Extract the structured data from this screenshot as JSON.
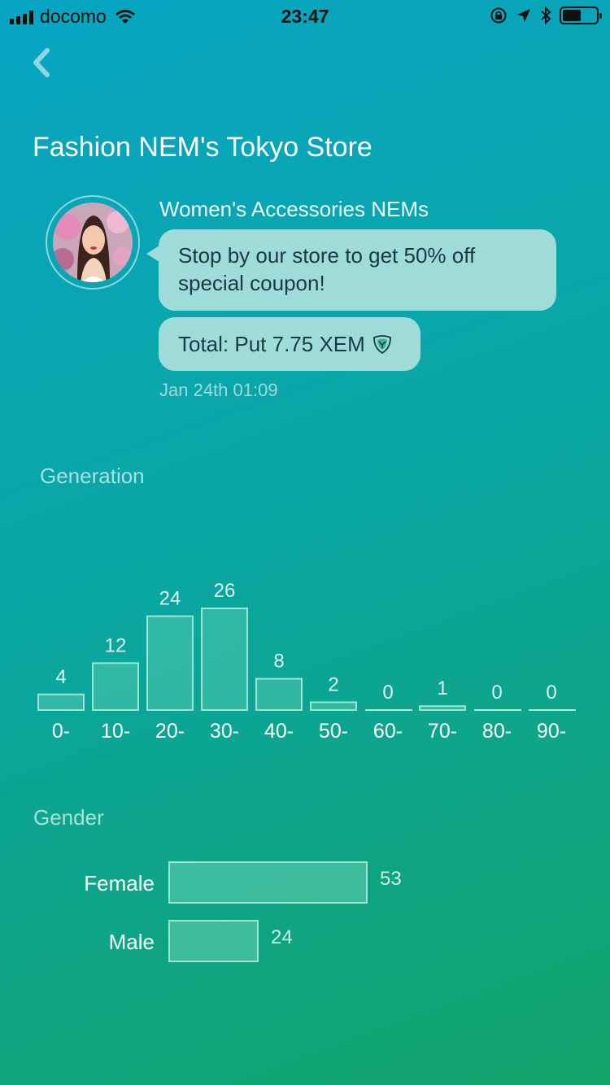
{
  "status_bar": {
    "carrier": "docomo",
    "time": "23:47",
    "battery_level": 0.55
  },
  "header": {
    "back_icon": "chevron-left-icon",
    "title": "Fashion NEM's Tokyo Store"
  },
  "message": {
    "sender": "Women's Accessories NEMs",
    "text": "Stop by our store to get 50% off special coupon!",
    "total": "Total: Put 7.75 XEM",
    "total_icon": "xem-coin-icon",
    "timestamp": "Jan 24th 01:09"
  },
  "generation": {
    "title": "Generation"
  },
  "gender": {
    "title": "Gender",
    "rows": [
      {
        "label": "Female",
        "value": 53,
        "display": "53"
      },
      {
        "label": "Male",
        "value": 24,
        "display": "24"
      }
    ]
  },
  "chart_data": {
    "type": "bar",
    "categories": [
      "0-",
      "10-",
      "20-",
      "30-",
      "40-",
      "50-",
      "60-",
      "70-",
      "80-",
      "90-"
    ],
    "values": [
      4,
      12,
      24,
      26,
      8,
      2,
      0,
      1,
      0,
      0
    ],
    "title": "Generation",
    "xlabel": "",
    "ylabel": "",
    "grid": false
  },
  "colors": {
    "bar_fill": "#4dbfa6",
    "bubble": "#9fdcd9",
    "bubble_text": "#173a44"
  }
}
